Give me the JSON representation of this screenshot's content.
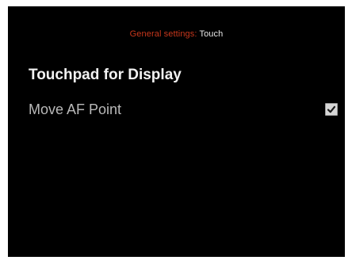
{
  "breadcrumb": {
    "parent": "General settings",
    "separator": ":",
    "current": "Touch"
  },
  "section": {
    "title": "Touchpad for Display"
  },
  "settings": [
    {
      "label": "Move AF Point",
      "checked": true,
      "icon": "checkmark-icon"
    }
  ],
  "colors": {
    "background": "#000000",
    "breadcrumb_parent": "#c7371c",
    "breadcrumb_current": "#e9e9e9",
    "title": "#f2f2f2",
    "setting_label": "#b9b9b9",
    "checkbox_fill": "#d6d6d6"
  }
}
